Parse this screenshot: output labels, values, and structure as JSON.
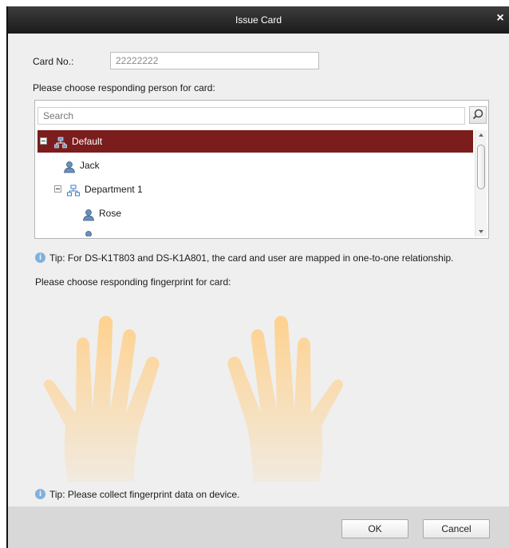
{
  "dialog": {
    "title": "Issue Card"
  },
  "card": {
    "label": "Card No.:",
    "value": "22222222"
  },
  "person": {
    "prompt": "Please choose responding person for card:",
    "search_placeholder": "Search",
    "tree": [
      {
        "label": "Default",
        "type": "group",
        "level": 0,
        "expanded": true,
        "selected": true
      },
      {
        "label": "Jack",
        "type": "person",
        "level": 1
      },
      {
        "label": "Department 1",
        "type": "group",
        "level": 1,
        "expanded": true
      },
      {
        "label": "Rose",
        "type": "person",
        "level": 2
      }
    ],
    "tip": "Tip: For DS-K1T803 and DS-K1A801, the card and user are mapped in one-to-one relationship."
  },
  "fingerprint": {
    "prompt": "Please choose responding fingerprint for card:",
    "tip": "Tip: Please collect fingerprint data on device."
  },
  "buttons": {
    "ok": "OK",
    "cancel": "Cancel"
  },
  "colors": {
    "selected_row": "#7b1d1d",
    "hand_fill": "#ffd08a",
    "info_icon": "#7fb1dd",
    "titlebar": "#2a2a2a"
  },
  "icons": {
    "close": "close-icon",
    "search": "search-icon",
    "group": "org-group-icon",
    "person": "person-icon",
    "info": "info-icon"
  }
}
